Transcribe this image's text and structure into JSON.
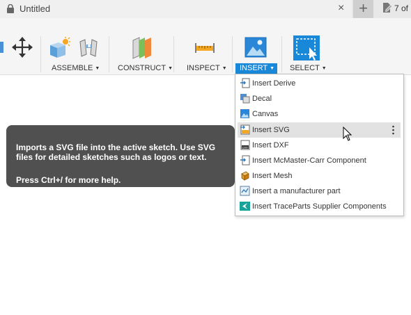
{
  "tab": {
    "title": "Untitled",
    "close": "×",
    "new_tab": "+",
    "pager": "7 of"
  },
  "toolbar": {
    "groups": [
      {
        "label": "ASSEMBLE"
      },
      {
        "label": "CONSTRUCT"
      },
      {
        "label": "INSPECT"
      },
      {
        "label": "INSERT"
      },
      {
        "label": "SELECT"
      }
    ]
  },
  "tooltip": {
    "description": "Imports a SVG file into the active sketch. Use SVG files for detailed sketches such as logos or text.",
    "help": "Press Ctrl+/ for more help."
  },
  "menu": {
    "items": [
      {
        "label": "Insert Derive",
        "icon": "insert-derive-icon"
      },
      {
        "label": "Decal",
        "icon": "decal-icon"
      },
      {
        "label": "Canvas",
        "icon": "canvas-icon"
      },
      {
        "label": "Insert SVG",
        "icon": "svg-icon",
        "highlighted": true
      },
      {
        "label": "Insert DXF",
        "icon": "dxf-icon"
      },
      {
        "label": "Insert McMaster-Carr Component",
        "icon": "mcmaster-icon"
      },
      {
        "label": "Insert Mesh",
        "icon": "mesh-icon"
      },
      {
        "label": "Insert a manufacturer part",
        "icon": "manufacturer-part-icon"
      },
      {
        "label": "Insert TraceParts Supplier Components",
        "icon": "traceparts-icon"
      }
    ]
  },
  "colors": {
    "accent": "#1a88d8",
    "tooltip_bg": "#505050",
    "highlight_row": "#e2e2e2"
  }
}
